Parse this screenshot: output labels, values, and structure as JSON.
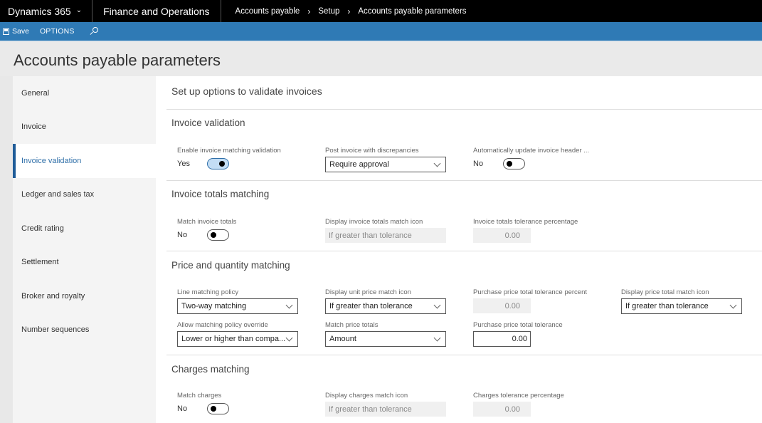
{
  "topbar": {
    "brand": "Dynamics 365",
    "app": "Finance and Operations",
    "breadcrumb": [
      "Accounts payable",
      "Setup",
      "Accounts payable parameters"
    ]
  },
  "actionbar": {
    "save_label": "Save",
    "options_label": "OPTIONS"
  },
  "page_title": "Accounts payable parameters",
  "leftnav": {
    "items": [
      {
        "label": "General"
      },
      {
        "label": "Invoice"
      },
      {
        "label": "Invoice validation",
        "active": true
      },
      {
        "label": "Ledger and sales tax"
      },
      {
        "label": "Credit rating"
      },
      {
        "label": "Settlement"
      },
      {
        "label": "Broker and royalty"
      },
      {
        "label": "Number sequences"
      }
    ]
  },
  "main": {
    "subtitle": "Set up options to validate invoices",
    "invoice_validation": {
      "title": "Invoice validation",
      "enable_matching": {
        "label": "Enable invoice matching validation",
        "value": "Yes",
        "on": true
      },
      "post_with_discrepancies": {
        "label": "Post invoice with discrepancies",
        "value": "Require approval"
      },
      "auto_update_header": {
        "label": "Automatically update invoice header ...",
        "value": "No",
        "on": false
      }
    },
    "invoice_totals": {
      "title": "Invoice totals matching",
      "match_totals": {
        "label": "Match invoice totals",
        "value": "No",
        "on": false
      },
      "display_icon": {
        "label": "Display invoice totals match icon",
        "value": "If greater than tolerance"
      },
      "tolerance_pct": {
        "label": "Invoice totals tolerance percentage",
        "value": "0.00"
      }
    },
    "price_quantity": {
      "title": "Price and quantity matching",
      "line_policy": {
        "label": "Line matching policy",
        "value": "Two-way matching"
      },
      "unit_price_icon": {
        "label": "Display unit price match icon",
        "value": "If greater than tolerance"
      },
      "price_total_pct": {
        "label": "Purchase price total tolerance percent",
        "value": "0.00"
      },
      "price_total_icon": {
        "label": "Display price total match icon",
        "value": "If greater than tolerance"
      },
      "policy_override": {
        "label": "Allow matching policy override",
        "value": "Lower or higher than compa..."
      },
      "match_price_totals": {
        "label": "Match price totals",
        "value": "Amount"
      },
      "price_total_tol": {
        "label": "Purchase price total tolerance",
        "value": "0.00"
      }
    },
    "charges": {
      "title": "Charges matching",
      "match_charges": {
        "label": "Match charges",
        "value": "No",
        "on": false
      },
      "display_icon": {
        "label": "Display charges match icon",
        "value": "If greater than tolerance"
      },
      "tolerance_pct": {
        "label": "Charges tolerance percentage",
        "value": "0.00"
      }
    }
  }
}
